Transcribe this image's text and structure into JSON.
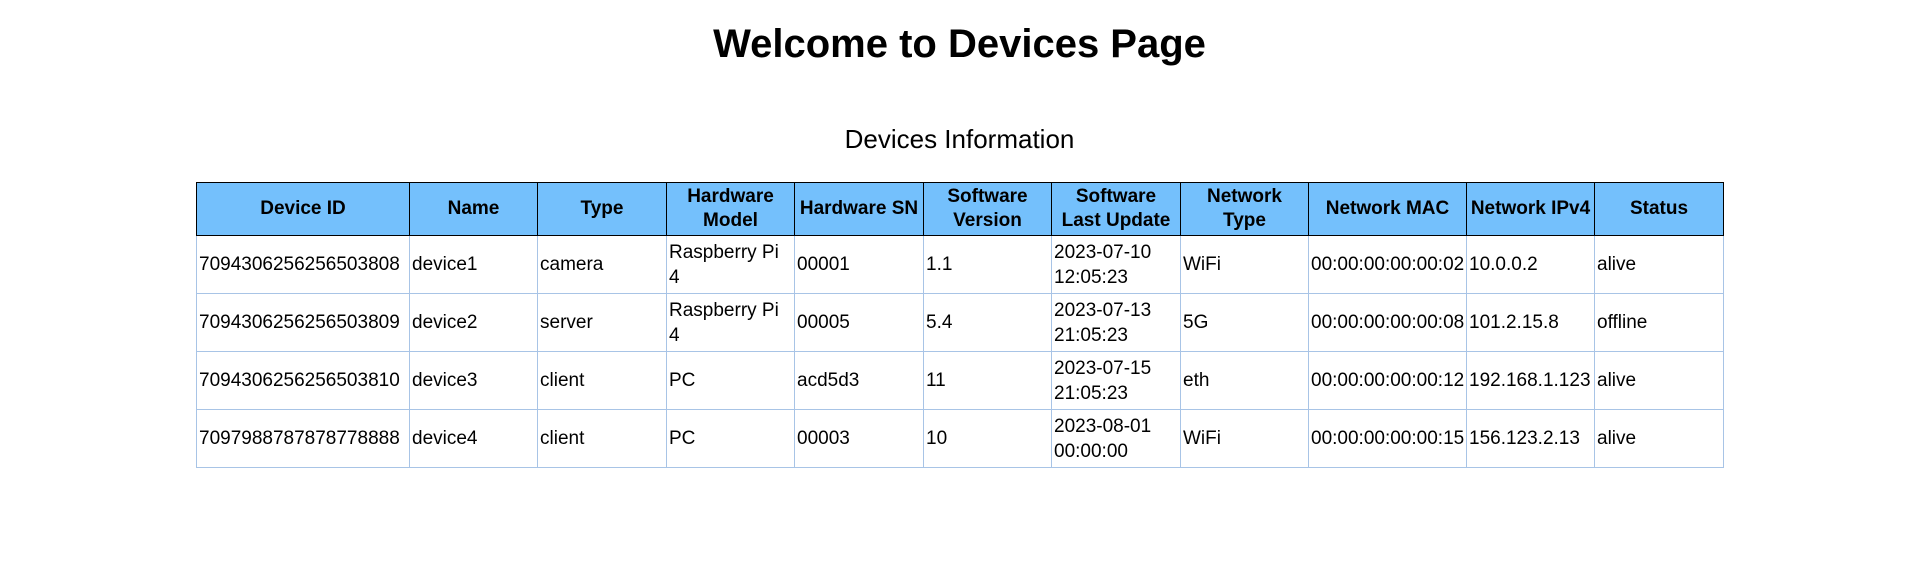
{
  "page": {
    "title": "Welcome to Devices Page",
    "caption": "Devices Information"
  },
  "table": {
    "headers": [
      "Device ID",
      "Name",
      "Type",
      "Hardware Model",
      "Hardware SN",
      "Software Version",
      "Software Last Update",
      "Network Type",
      "Network MAC",
      "Network IPv4",
      "Status"
    ],
    "rows": [
      [
        "7094306256256503808",
        "device1",
        "camera",
        "Raspberry Pi 4",
        "00001",
        "1.1",
        "2023-07-10 12:05:23",
        "WiFi",
        "00:00:00:00:00:02",
        "10.0.0.2",
        "alive"
      ],
      [
        "7094306256256503809",
        "device2",
        "server",
        "Raspberry Pi 4",
        "00005",
        "5.4",
        "2023-07-13 21:05:23",
        "5G",
        "00:00:00:00:00:08",
        "101.2.15.8",
        "offline"
      ],
      [
        "7094306256256503810",
        "device3",
        "client",
        "PC",
        "acd5d3",
        "11",
        "2023-07-15 21:05:23",
        "eth",
        "00:00:00:00:00:12",
        "192.168.1.123",
        "alive"
      ],
      [
        "7097988787878778888",
        "device4",
        "client",
        "PC",
        "00003",
        "10",
        "2023-08-01 00:00:00",
        "WiFi",
        "00:00:00:00:00:15",
        "156.123.2.13",
        "alive"
      ]
    ]
  },
  "colors": {
    "header_bg": "#74c0fc",
    "cell_border": "#a8c4e6"
  }
}
